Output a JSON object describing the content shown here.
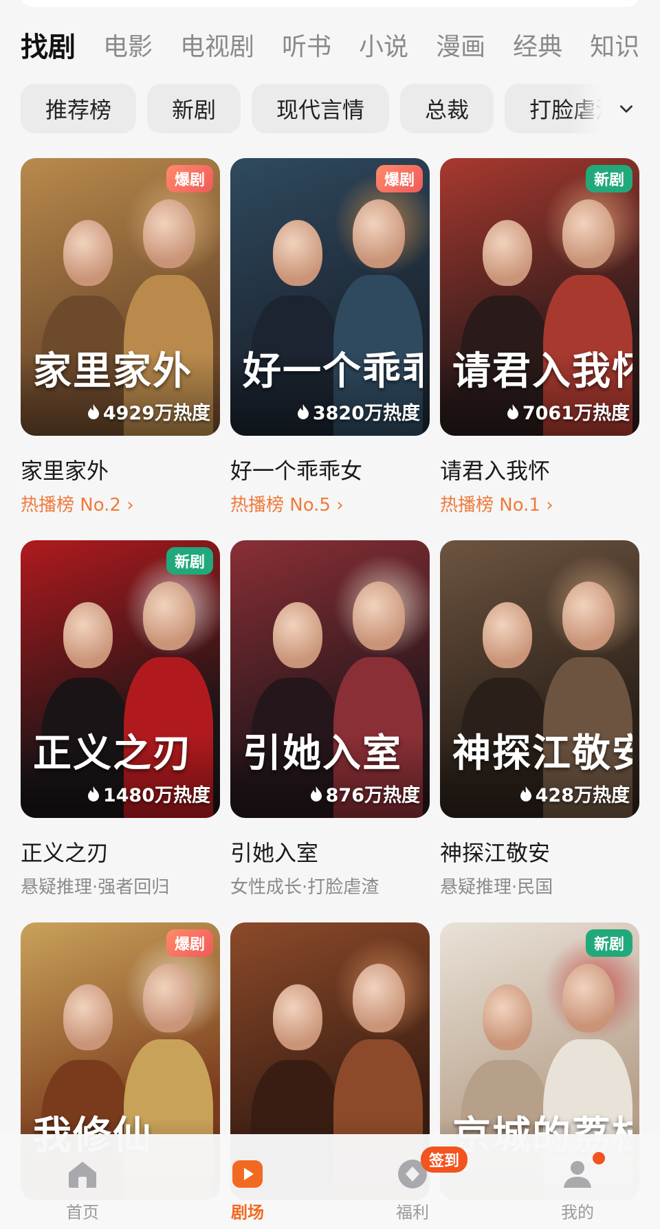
{
  "category_tabs": [
    "找剧",
    "电影",
    "电视剧",
    "听书",
    "小说",
    "漫画",
    "经典",
    "知识"
  ],
  "filter_chips": [
    "推荐榜",
    "新剧",
    "现代言情",
    "总裁",
    "打脸虐渣"
  ],
  "cards": [
    {
      "poster_title": "家里家外",
      "title": "家里家外",
      "badge": "爆剧",
      "badge_type": "hot",
      "heat": "4929万热度",
      "subtitle": "热播榜 No.2 ›",
      "subtitle_type": "rank",
      "palette": [
        "#b98a4c",
        "#6e4a2c",
        "#d8b27a"
      ]
    },
    {
      "poster_title": "好一个乖乖女",
      "title": "好一个乖乖女",
      "badge": "爆剧",
      "badge_type": "hot",
      "heat": "3820万热度",
      "subtitle": "热播榜 No.5 ›",
      "subtitle_type": "rank",
      "palette": [
        "#2f4a5f",
        "#1b2430",
        "#c98a4a"
      ]
    },
    {
      "poster_title": "请君入我怀",
      "title": "请君入我怀",
      "badge": "新剧",
      "badge_type": "new",
      "heat": "7061万热度",
      "subtitle": "热播榜 No.1 ›",
      "subtitle_type": "rank",
      "palette": [
        "#a8392f",
        "#2a1a1a",
        "#e3a27a"
      ]
    },
    {
      "poster_title": "正义之刃",
      "title": "正义之刃",
      "badge": "新剧",
      "badge_type": "new",
      "heat": "1480万热度",
      "subtitle": "悬疑推理·强者回归",
      "subtitle_type": "tags",
      "palette": [
        "#b01a1e",
        "#1a1416",
        "#e0e0e0"
      ]
    },
    {
      "poster_title": "引她入室",
      "title": "引她入室",
      "badge": "",
      "badge_type": "",
      "heat": "876万热度",
      "subtitle": "女性成长·打脸虐渣",
      "subtitle_type": "tags",
      "palette": [
        "#8a2f36",
        "#24161a",
        "#e8d8c8"
      ]
    },
    {
      "poster_title": "神探江敬安",
      "title": "神探江敬安",
      "badge": "",
      "badge_type": "",
      "heat": "428万热度",
      "subtitle": "悬疑推理·民国",
      "subtitle_type": "tags",
      "palette": [
        "#6d5440",
        "#2b2019",
        "#c8a27c"
      ]
    },
    {
      "poster_title": "我修仙",
      "title": "",
      "badge": "爆剧",
      "badge_type": "hot",
      "heat": "",
      "subtitle": "",
      "subtitle_type": "tags",
      "palette": [
        "#c9a25a",
        "#7a3a1c",
        "#f2e6cf"
      ]
    },
    {
      "poster_title": "",
      "title": "",
      "badge": "",
      "badge_type": "",
      "heat": "",
      "subtitle": "",
      "subtitle_type": "tags",
      "palette": [
        "#8c4a2a",
        "#3a1d12",
        "#d08a5a"
      ]
    },
    {
      "poster_title": "京城的荔枝",
      "title": "",
      "badge": "新剧",
      "badge_type": "new",
      "heat": "",
      "subtitle": "",
      "subtitle_type": "tags",
      "palette": [
        "#e9e2d8",
        "#b7a08a",
        "#c23a3a"
      ]
    }
  ],
  "bottom_nav": [
    {
      "label": "首页",
      "icon": "home-icon",
      "active": false
    },
    {
      "label": "剧场",
      "icon": "play-icon",
      "active": true
    },
    {
      "label": "福利",
      "icon": "gift-icon",
      "active": false,
      "badge": "签到"
    },
    {
      "label": "我的",
      "icon": "profile-icon",
      "active": false
    }
  ],
  "colors": {
    "accent": "#f2691f",
    "hot_badge": "#f05a5a",
    "new_badge": "#21a97b",
    "rank_text": "#f07a3a"
  }
}
